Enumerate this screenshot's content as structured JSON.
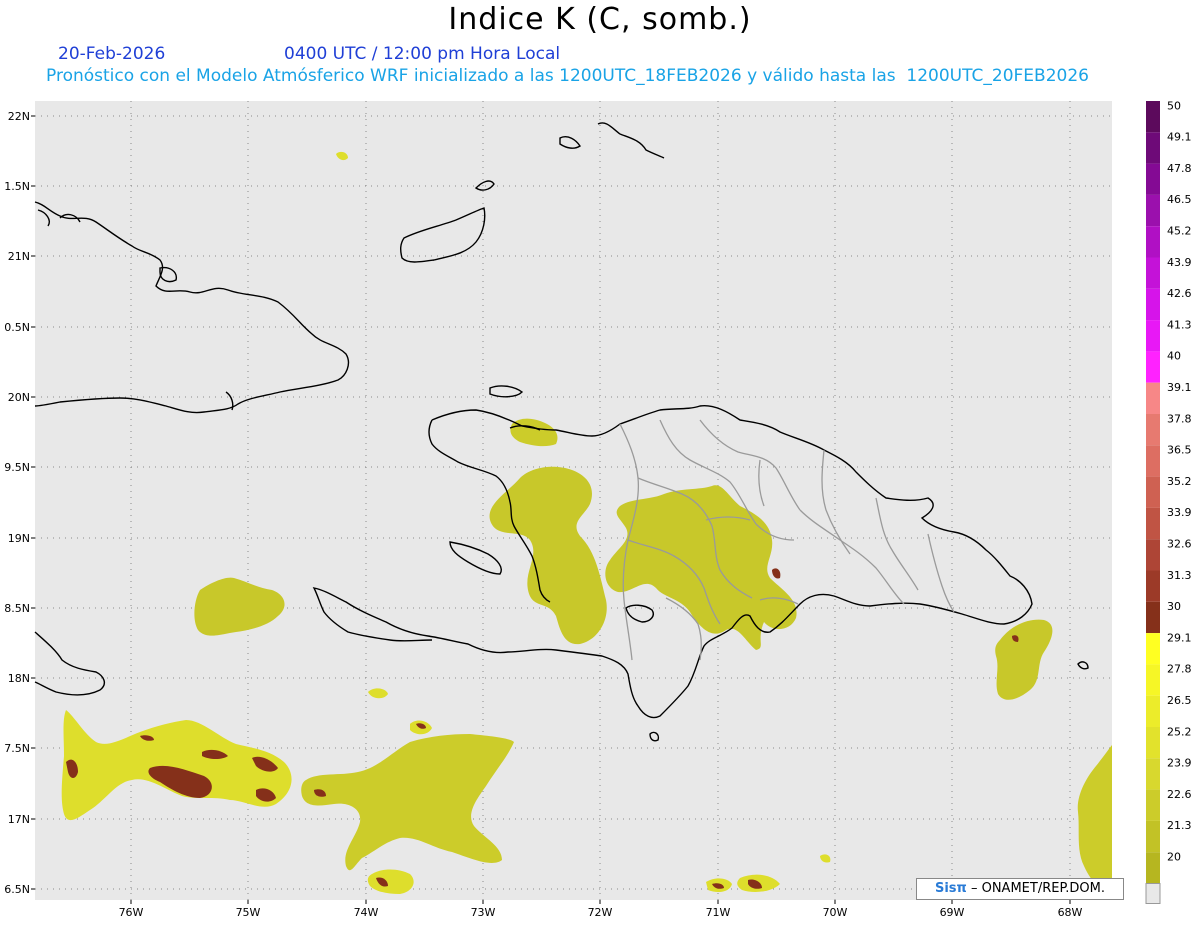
{
  "header": {
    "title": "Indice K (C, somb.)",
    "date": "20-Feb-2026",
    "time": "0400 UTC / 12:00 pm Hora Local",
    "forecast": "Pronóstico con el Modelo Atmósferico WRF inicializado a las 1200UTC_18FEB2026 y válido hasta las  1200UTC_20FEB2026"
  },
  "map": {
    "lat_labels": [
      "22N",
      "1.5N",
      "21N",
      "0.5N",
      "20N",
      "9.5N",
      "19N",
      "8.5N",
      "18N",
      "7.5N",
      "17N",
      "6.5N"
    ],
    "lon_labels": [
      "76W",
      "75W",
      "74W",
      "73W",
      "72W",
      "71W",
      "70W",
      "69W",
      "68W"
    ],
    "background_color": "#e8e8e8",
    "grid": "dotted"
  },
  "colorbar": {
    "labels": [
      "50",
      "49.1",
      "47.8",
      "46.5",
      "45.2",
      "43.9",
      "42.6",
      "41.3",
      "40",
      "39.1",
      "37.8",
      "36.5",
      "35.2",
      "33.9",
      "32.6",
      "31.3",
      "30",
      "29.1",
      "27.8",
      "26.5",
      "25.2",
      "23.9",
      "22.6",
      "21.3",
      "20"
    ],
    "colors": [
      "#5c0a5c",
      "#6e0a78",
      "#840a94",
      "#9b10ad",
      "#b010c4",
      "#c412d8",
      "#d614ea",
      "#e818f6",
      "#ff22ff",
      "#f78787",
      "#e77a70",
      "#dd6e62",
      "#cf6152",
      "#c05444",
      "#ae4536",
      "#9c3a28",
      "#85301a",
      "#ffff22",
      "#f6f626",
      "#ecec2a",
      "#e2e22c",
      "#d8d82e",
      "#cccc2a",
      "#c2c226",
      "#b6b620"
    ],
    "bottom_swatch": "#e8e8e8"
  },
  "credit": {
    "logo": "Sisπ",
    "text": "– ONAMET/REP.DOM."
  }
}
